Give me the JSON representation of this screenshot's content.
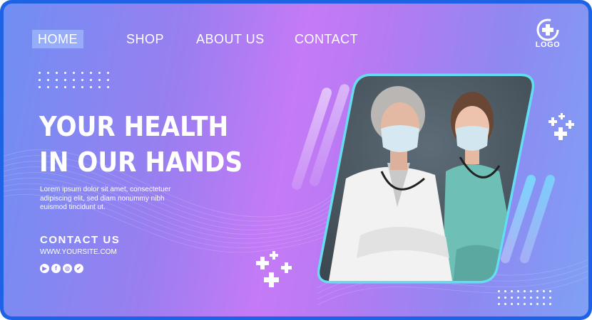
{
  "nav": {
    "items": [
      {
        "label": "HOME",
        "active": true
      },
      {
        "label": "SHOP",
        "active": false
      },
      {
        "label": "ABOUT US",
        "active": false
      },
      {
        "label": "CONTACT",
        "active": false
      }
    ]
  },
  "logo": {
    "text": "LOGO",
    "icon": "medical-cross-icon"
  },
  "hero": {
    "headline_line1": "YOUR HEALTH",
    "headline_line2": "IN OUR HANDS",
    "body_line1": "Lorem ipsum dolor sit amet, consectetuer",
    "body_line2": "adipiscing elit, sed diam nonummy nibh",
    "body_line3": "euismod tincidunt ut."
  },
  "contact": {
    "title": "CONTACT US",
    "website": "WWW.YOURSITE.COM",
    "social_icons": [
      "youtube-icon",
      "facebook-icon",
      "instagram-icon",
      "twitter-icon"
    ]
  },
  "image": {
    "subject": "two-doctors-in-masks-photo"
  },
  "colors": {
    "frame": "#1e63e6",
    "accent_cyan": "#5ee6f0",
    "text": "#ffffff"
  }
}
